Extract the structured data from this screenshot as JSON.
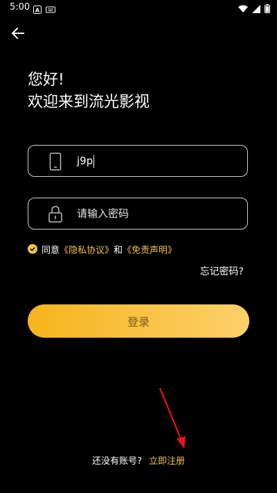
{
  "status_bar": {
    "time": "5:00",
    "icons": [
      "notification-a-icon",
      "keyboard-icon",
      "wifi-icon",
      "signal-icon",
      "battery-icon"
    ]
  },
  "back_icon": "arrow-left-icon",
  "greeting": {
    "line1": "您好!",
    "line2": "欢迎来到流光影视"
  },
  "phone_field": {
    "icon": "phone-icon",
    "value": "j9p"
  },
  "password_field": {
    "icon": "lock-icon",
    "placeholder": "请输入密码"
  },
  "agreement": {
    "checked": true,
    "prefix": "同意",
    "privacy_link": "《隐私协议》",
    "and": "和",
    "disclaimer_link": "《免责声明》"
  },
  "forgot_password": "忘记密码?",
  "login_button": "登录",
  "register": {
    "prompt": "还没有账号?",
    "link": "立即注册"
  },
  "colors": {
    "background": "#000000",
    "accent": "#f6c244",
    "button_gradient_start": "#f7b41c",
    "button_gradient_end": "#fcd06a",
    "annotation_arrow": "#e8141c"
  }
}
